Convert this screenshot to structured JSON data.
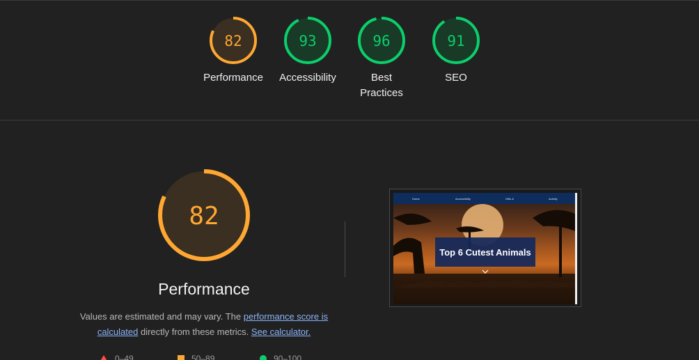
{
  "scores": [
    {
      "id": "performance",
      "value": "82",
      "score": 82,
      "label": "Performance",
      "status": "average"
    },
    {
      "id": "accessibility",
      "value": "93",
      "score": 93,
      "label": "Accessibility",
      "status": "pass"
    },
    {
      "id": "best-practices",
      "value": "96",
      "score": 96,
      "label_line1": "Best",
      "label_line2": "Practices",
      "status": "pass"
    },
    {
      "id": "seo",
      "value": "91",
      "score": 91,
      "label": "SEO",
      "status": "pass"
    }
  ],
  "main": {
    "score_value": "82",
    "score": 82,
    "title": "Performance",
    "desc_part1": "Values are estimated and may vary. The ",
    "desc_link1": "performance score is calculated",
    "desc_part2": " directly from these metrics. ",
    "desc_link2": "See calculator."
  },
  "legend": [
    {
      "icon": "triangle-icon",
      "label": "0–49"
    },
    {
      "icon": "square-icon",
      "label": "50–89"
    },
    {
      "icon": "circle-icon",
      "label": "90–100"
    }
  ],
  "screenshot": {
    "nav": [
      "Home",
      "Accessibility",
      "Gifts & ",
      "Activity"
    ],
    "title": "Top 6 Cutest Animals"
  },
  "colors": {
    "background": "#212121",
    "average": "#ffa733",
    "average_bg": "#3a2f20",
    "pass": "#0cce6b",
    "pass_bg": "#183a27",
    "fail": "#ff4e42",
    "link": "#8ab4f8"
  }
}
